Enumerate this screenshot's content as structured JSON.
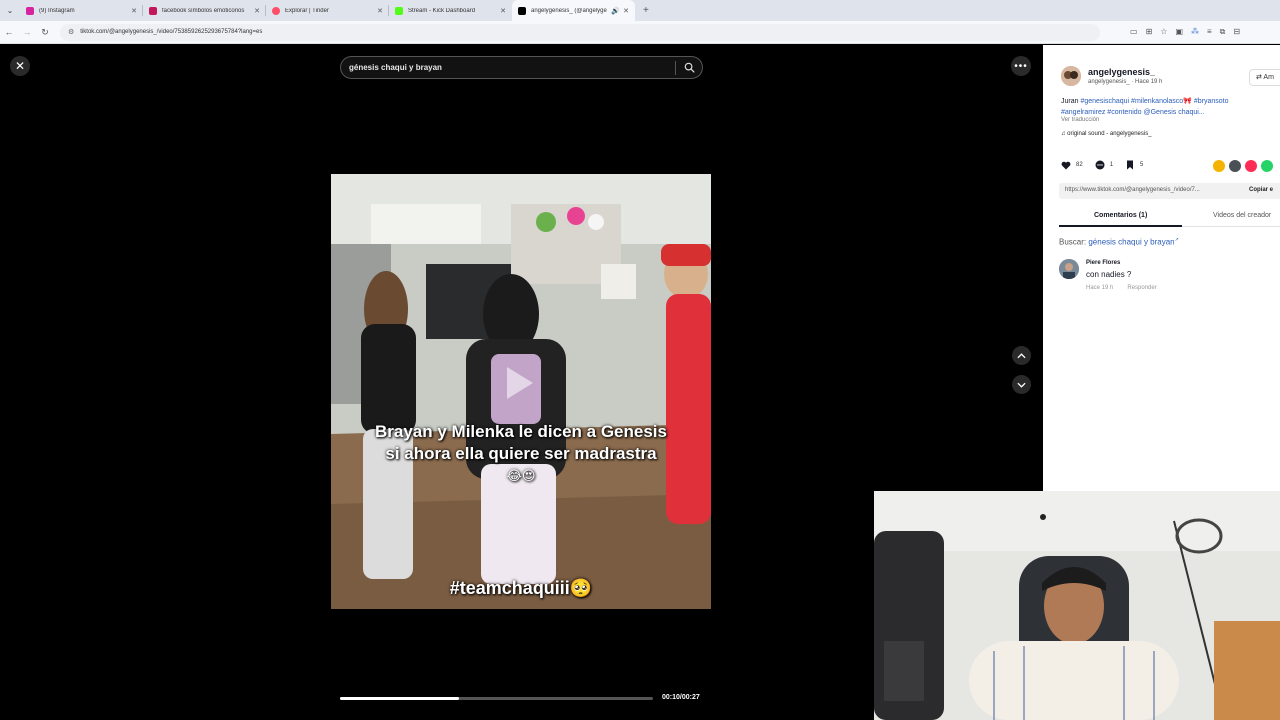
{
  "tabs": [
    {
      "title": "(9) Instagram",
      "color": "#d6249f"
    },
    {
      "title": "facebook símbolos emoticonos",
      "color": "#c2185b"
    },
    {
      "title": "Explorar | Tinder",
      "color": "#fd5068"
    },
    {
      "title": "Stream - Kick Dashboard",
      "color": "#53fc18"
    },
    {
      "title": "angelygenesis_ (@angelyge",
      "color": "#000000"
    }
  ],
  "address": {
    "url": "tiktok.com/@angelygenesis_/video/7538592625293675784?lang=es"
  },
  "search": {
    "query": "génesis chaqui y brayan"
  },
  "video": {
    "caption_line1": "Brayan y Milenka le dicen a Genesis",
    "caption_line2": "si ahora ella quiere ser madrastra",
    "caption_emoji": "😂😍",
    "hashtag": "#teamchaquiii🥺",
    "time": "00:10/00:27",
    "progress": 0.38
  },
  "post": {
    "username": "angelygenesis_",
    "handle": "angelygenesis_",
    "age": " · Hace 19 h",
    "follow_label": "⇄ Am",
    "desc_prefix": "Juran ",
    "hashtags1": "#genesischaqui #milenkanolasco🎀 #bryansoto",
    "hashtags2": "#angelramirez #contenido @Genesis chaqui...",
    "translate": "Ver traducción",
    "sound": "original sound - angelygenesis_",
    "likes": "82",
    "comments": "1",
    "saves": "5",
    "link": "https://www.tiktok.com/@angelygenesis_/video/7...",
    "copy_label": "Copiar e",
    "tab_comments": "Comentarios (1)",
    "tab_creator": "Videos del creador",
    "search_label": "Buscar: ",
    "search_query": "génesis chaqui y brayan",
    "comment": {
      "name": "Piere Flores",
      "text": "con nadies ?",
      "age": "Hace 19 h",
      "reply": "Responder"
    }
  },
  "colors": {
    "accent": "#2b5db9",
    "background": "#000000"
  }
}
